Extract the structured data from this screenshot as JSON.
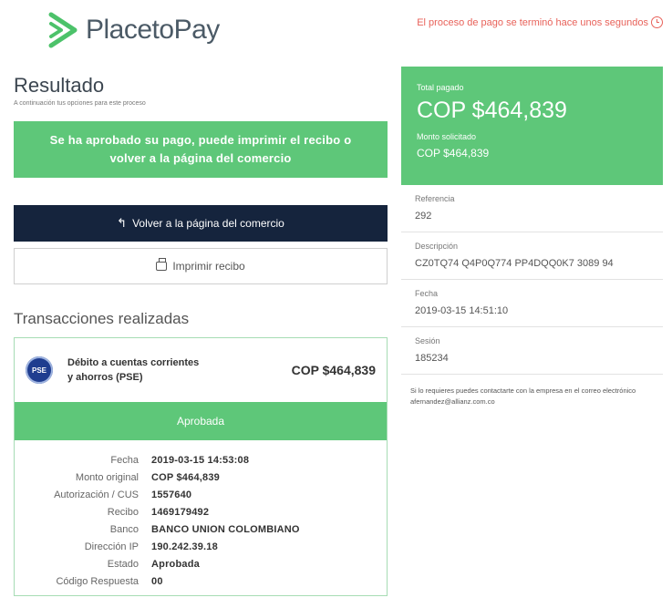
{
  "header": {
    "logo_text": "PlacetoPay",
    "process_message": "El proceso de pago se terminó hace unos segundos"
  },
  "result": {
    "title": "Resultado",
    "subtitle": "A continuación tus opciones para este proceso",
    "approved_message": "Se ha aprobado su pago, puede imprimir el recibo o volver a la página del comercio",
    "return_button": "Volver a la página del comercio",
    "print_button": "Imprimir recibo"
  },
  "transactions": {
    "section_title": "Transacciones realizadas",
    "items": [
      {
        "method_icon": "PSE",
        "method": "Débito a cuentas corrientes y ahorros (PSE)",
        "amount": "COP $464,839",
        "status": "Aprobada",
        "details": [
          {
            "label": "Fecha",
            "value": "2019-03-15 14:53:08"
          },
          {
            "label": "Monto original",
            "value": "COP $464,839"
          },
          {
            "label": "Autorización / CUS",
            "value": "1557640"
          },
          {
            "label": "Recibo",
            "value": "1469179492"
          },
          {
            "label": "Banco",
            "value": "BANCO UNION COLOMBIANO"
          },
          {
            "label": "Dirección IP",
            "value": "190.242.39.18"
          },
          {
            "label": "Estado",
            "value": "Aprobada"
          },
          {
            "label": "Código Respuesta",
            "value": "00"
          }
        ]
      }
    ]
  },
  "summary": {
    "total_label": "Total pagado",
    "total_value": "COP $464,839",
    "requested_label": "Monto solicitado",
    "requested_value": "COP $464,839",
    "info": [
      {
        "label": "Referencia",
        "value": "292"
      },
      {
        "label": "Descripción",
        "value": "CZ0TQ74 Q4P0Q774 PP4DQQ0K7 3089 94"
      },
      {
        "label": "Fecha",
        "value": "2019-03-15 14:51:10"
      },
      {
        "label": "Sesión",
        "value": "185234"
      }
    ],
    "contact_text": "Si lo requieres puedes contactarte con la empresa en el correo electrónico afernandez@allianz.com.co"
  },
  "colors": {
    "accent_green": "#5ec779",
    "navy": "#15243d",
    "alert_red": "#e8625a"
  }
}
